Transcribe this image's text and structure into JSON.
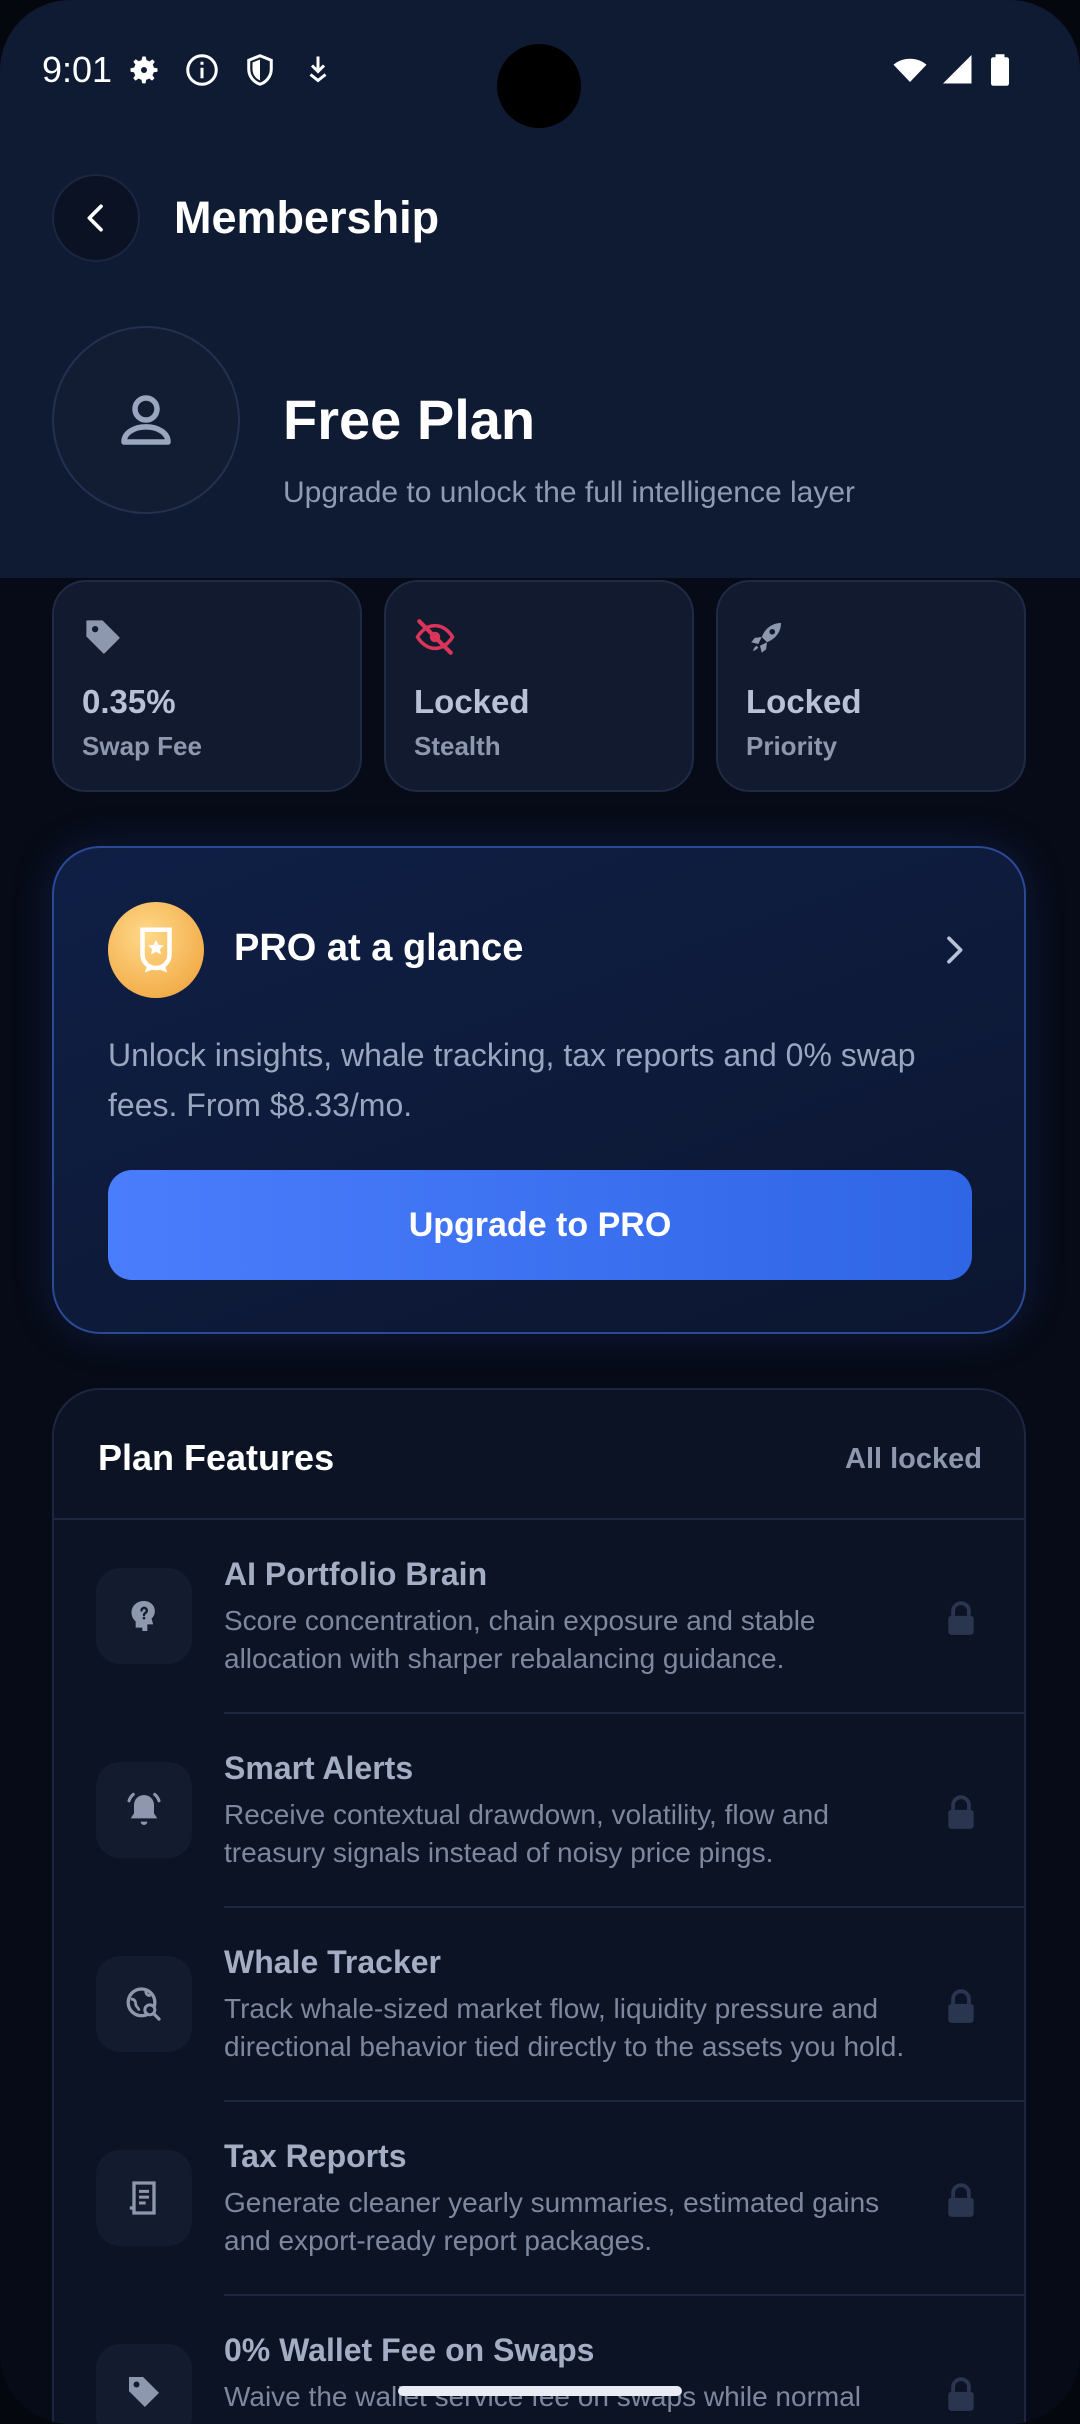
{
  "status_bar": {
    "time": "9:01",
    "left_icons": [
      "settings-icon",
      "info-icon",
      "shield-icon",
      "download-icon"
    ],
    "right_icons": [
      "wifi-icon",
      "signal-icon",
      "battery-icon"
    ]
  },
  "header": {
    "title": "Membership"
  },
  "plan": {
    "name": "Free Plan",
    "subtitle": "Upgrade to unlock the full intelligence layer"
  },
  "stats": [
    {
      "icon": "tag-icon",
      "value": "0.35%",
      "label": "Swap Fee",
      "color": "#8d97ae"
    },
    {
      "icon": "eye-off-icon",
      "value": "Locked",
      "label": "Stealth",
      "color": "#d9345a"
    },
    {
      "icon": "rocket-icon",
      "value": "Locked",
      "label": "Priority",
      "color": "#8d97ae"
    }
  ],
  "pro_card": {
    "title": "PRO at a glance",
    "description": "Unlock insights, whale tracking, tax reports and 0% swap fees. From $8.33/mo.",
    "button_label": "Upgrade to PRO"
  },
  "features": {
    "title": "Plan Features",
    "status": "All locked",
    "items": [
      {
        "icon": "brain-icon",
        "name": "AI Portfolio Brain",
        "description": "Score concentration, chain exposure and stable allocation with sharper rebalancing guidance."
      },
      {
        "icon": "bell-icon",
        "name": "Smart Alerts",
        "description": "Receive contextual drawdown, volatility, flow and treasury signals instead of noisy price pings."
      },
      {
        "icon": "globe-search-icon",
        "name": "Whale Tracker",
        "description": "Track whale-sized market flow, liquidity pressure and directional behavior tied directly to the assets you hold."
      },
      {
        "icon": "receipt-icon",
        "name": "Tax Reports",
        "description": "Generate cleaner yearly summaries, estimated gains and export-ready report packages."
      },
      {
        "icon": "tag-icon",
        "name": "0% Wallet Fee on Swaps",
        "description": "Waive the wallet service fee on swaps while normal network fees still apply."
      }
    ]
  },
  "colors": {
    "accent": "#3d73f5",
    "background": "#070b17",
    "header_bg": "#0f1a33",
    "badge_gold": "#f3b04e",
    "stealth_red": "#d9345a"
  }
}
